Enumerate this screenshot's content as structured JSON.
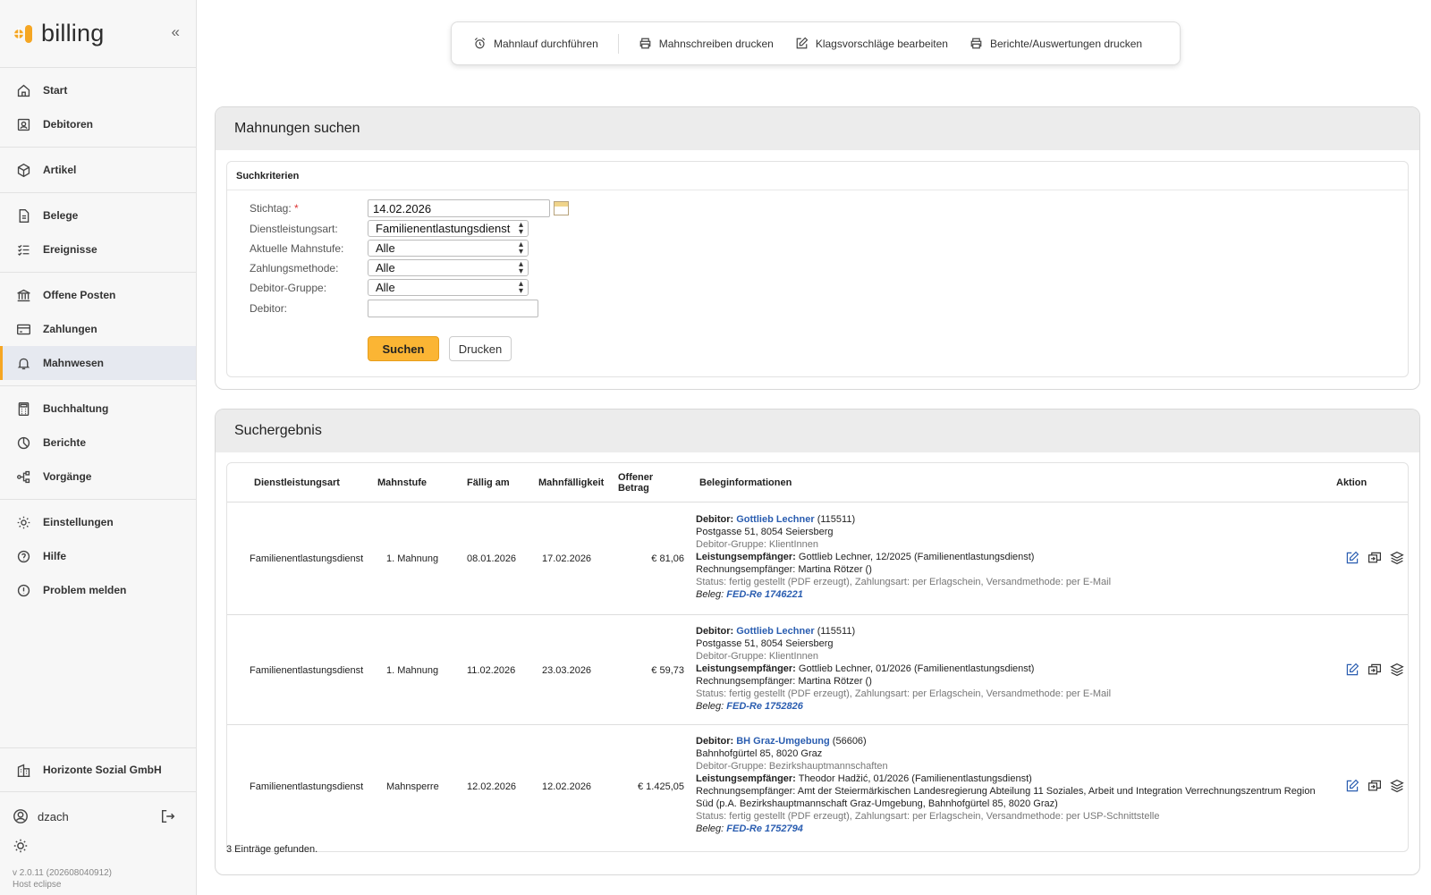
{
  "app": {
    "name": "billing",
    "collapse_icon": "double-chevron-left-icon"
  },
  "sidebar": {
    "groups": [
      [
        {
          "label": "Start",
          "icon": "home-icon"
        },
        {
          "label": "Debitoren",
          "icon": "contacts-icon"
        }
      ],
      [
        {
          "label": "Artikel",
          "icon": "package-icon"
        }
      ],
      [
        {
          "label": "Belege",
          "icon": "document-icon"
        },
        {
          "label": "Ereignisse",
          "icon": "list-check-icon"
        }
      ],
      [
        {
          "label": "Offene Posten",
          "icon": "bank-icon"
        },
        {
          "label": "Zahlungen",
          "icon": "card-icon"
        },
        {
          "label": "Mahnwesen",
          "icon": "bell-icon",
          "active": true
        }
      ],
      [
        {
          "label": "Buchhaltung",
          "icon": "calculator-icon"
        },
        {
          "label": "Berichte",
          "icon": "pie-chart-icon"
        },
        {
          "label": "Vorgänge",
          "icon": "workflow-icon"
        }
      ],
      [
        {
          "label": "Einstellungen",
          "icon": "gear-icon"
        },
        {
          "label": "Hilfe",
          "icon": "help-icon"
        },
        {
          "label": "Problem melden",
          "icon": "alert-icon"
        }
      ]
    ],
    "organization": "Horizonte Sozial GmbH",
    "user": "dzach",
    "version": "v 2.0.11 (202608040912)",
    "host": "Host eclipse"
  },
  "toolbar": {
    "buttons": [
      {
        "label": "Mahnlauf durchführen",
        "icon": "alarm-clock-icon"
      },
      {
        "label": "Mahnschreiben drucken",
        "icon": "printer-icon"
      },
      {
        "label": "Klagsvorschläge bearbeiten",
        "icon": "edit-icon"
      },
      {
        "label": "Berichte/Auswertungen drucken",
        "icon": "printer-icon"
      }
    ]
  },
  "search": {
    "title": "Mahnungen suchen",
    "criteria_title": "Suchkriterien",
    "fields": {
      "stichtag_label": "Stichtag:",
      "stichtag_value": "14.02.2026",
      "dienstleistung_label": "Dienstleistungsart:",
      "dienstleistung_value": "Familienentlastungsdienst",
      "mahnstufe_label": "Aktuelle Mahnstufe:",
      "mahnstufe_value": "Alle",
      "zahlung_label": "Zahlungsmethode:",
      "zahlung_value": "Alle",
      "gruppe_label": "Debitor-Gruppe:",
      "gruppe_value": "Alle",
      "debitor_label": "Debitor:",
      "debitor_value": ""
    },
    "search_button": "Suchen",
    "print_button": "Drucken"
  },
  "results": {
    "title": "Suchergebnis",
    "columns": [
      "Dienstleistungsart",
      "Mahnstufe",
      "Fällig am",
      "Mahnfälligkeit",
      "Offener",
      "Betrag",
      "Beleginformationen",
      "Aktion"
    ],
    "rows": [
      {
        "dienstleistungsart": "Familienentlastungsdienst",
        "mahnstufe": "1. Mahnung",
        "faellig": "08.01.2026",
        "mahnfaelligkeit": "17.02.2026",
        "betrag": "€ 81,06",
        "debitor_label": "Debitor:",
        "debitor_name": "Gottlieb Lechner",
        "debitor_id": "(115511)",
        "address": "Postgasse 51, 8054 Seiersberg",
        "group": "Debitor-Gruppe: KlientInnen",
        "le_label": "Leistungsempfänger:",
        "le_value": "Gottlieb Lechner, 12/2025 (Familienentlastungsdienst)",
        "re": "Rechnungsempfänger: Martina Rötzer ()",
        "status": "Status: fertig gestellt (PDF erzeugt), Zahlungsart: per Erlagschein, Versandmethode: per E-Mail",
        "beleg_label": "Beleg:",
        "beleg": "FED-Re 1746221"
      },
      {
        "dienstleistungsart": "Familienentlastungsdienst",
        "mahnstufe": "1. Mahnung",
        "faellig": "11.02.2026",
        "mahnfaelligkeit": "23.03.2026",
        "betrag": "€ 59,73",
        "debitor_label": "Debitor:",
        "debitor_name": "Gottlieb Lechner",
        "debitor_id": "(115511)",
        "address": "Postgasse 51, 8054 Seiersberg",
        "group": "Debitor-Gruppe: KlientInnen",
        "le_label": "Leistungsempfänger:",
        "le_value": "Gottlieb Lechner, 01/2026 (Familienentlastungsdienst)",
        "re": "Rechnungsempfänger: Martina Rötzer ()",
        "status": "Status: fertig gestellt (PDF erzeugt), Zahlungsart: per Erlagschein, Versandmethode: per E-Mail",
        "beleg_label": "Beleg:",
        "beleg": "FED-Re 1752826"
      },
      {
        "dienstleistungsart": "Familienentlastungsdienst",
        "mahnstufe": "Mahnsperre",
        "faellig": "12.02.2026",
        "mahnfaelligkeit": "12.02.2026",
        "betrag": "€ 1.425,05",
        "debitor_label": "Debitor:",
        "debitor_name": "BH Graz-Umgebung",
        "debitor_id": "(56606)",
        "address": "Bahnhofgürtel 85, 8020 Graz",
        "group": "Debitor-Gruppe: Bezirkshauptmannschaften",
        "le_label": "Leistungsempfänger:",
        "le_value": "Theodor Hadžić, 01/2026 (Familienentlastungsdienst)",
        "re": "Rechnungsempfänger: Amt der Steiermärkischen Landesregierung Abteilung 11 Soziales, Arbeit und Integration Verrechnungszentrum Region Süd (p.A. Bezirkshauptmannschaft Graz-Umgebung, Bahnhofgürtel 85, 8020 Graz)",
        "status": "Status: fertig gestellt (PDF erzeugt), Zahlungsart: per Erlagschein, Versandmethode: per USP-Schnittstelle",
        "beleg_label": "Beleg:",
        "beleg": "FED-Re 1752794"
      }
    ],
    "count_text": "3 Einträge gefunden."
  },
  "colors": {
    "accent": "#fbb534",
    "link": "#2a5db0",
    "active_bg": "#e6e9f0"
  }
}
